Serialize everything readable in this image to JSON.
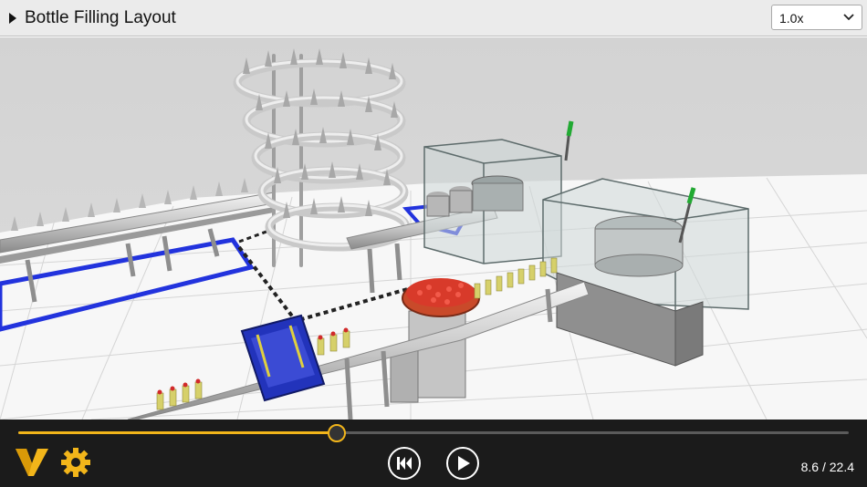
{
  "header": {
    "title": "Bottle Filling Layout",
    "speed": {
      "value": "1.0x"
    }
  },
  "playback": {
    "current": 8.6,
    "total": 22.4,
    "time_label": "8.6 / 22.4"
  },
  "colors": {
    "accent": "#f2b51a",
    "bar": "#1b1b1b",
    "header": "#ebebeb",
    "zone_outline": "#2233dd",
    "tray": "#2233bb"
  },
  "icons": [
    "caret-right-icon",
    "chevron-down-icon",
    "logo-v-icon",
    "gear-icon",
    "skip-back-icon",
    "play-icon"
  ]
}
